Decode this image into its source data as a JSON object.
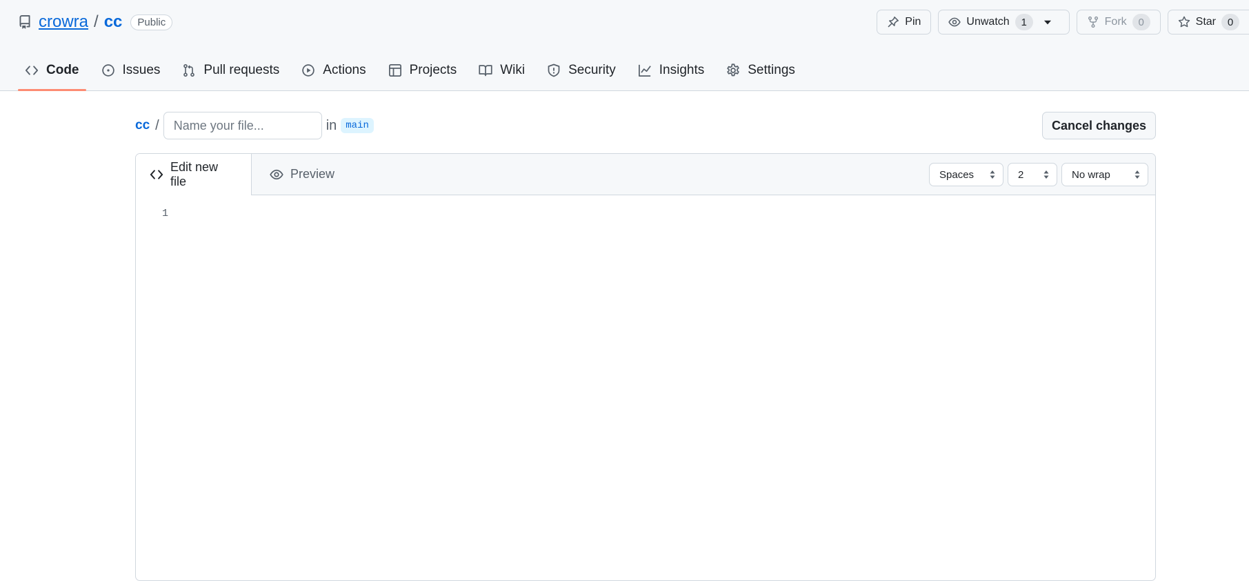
{
  "repo": {
    "owner": "crowra",
    "separator": "/",
    "name": "cc",
    "visibility": "Public"
  },
  "actions": {
    "pin_label": "Pin",
    "watch_label": "Unwatch",
    "watch_count": "1",
    "fork_label": "Fork",
    "fork_count": "0",
    "star_label": "Star",
    "star_count": "0"
  },
  "nav": {
    "items": [
      {
        "label": "Code",
        "icon": "code-icon",
        "active": true
      },
      {
        "label": "Issues",
        "icon": "issue-icon"
      },
      {
        "label": "Pull requests",
        "icon": "pull-request-icon"
      },
      {
        "label": "Actions",
        "icon": "play-icon"
      },
      {
        "label": "Projects",
        "icon": "table-icon"
      },
      {
        "label": "Wiki",
        "icon": "book-icon"
      },
      {
        "label": "Security",
        "icon": "shield-icon"
      },
      {
        "label": "Insights",
        "icon": "graph-icon"
      },
      {
        "label": "Settings",
        "icon": "gear-icon"
      }
    ]
  },
  "path": {
    "repo": "cc",
    "separator": "/",
    "filename_value": "",
    "filename_placeholder": "Name your file...",
    "in_label": "in",
    "branch": "main"
  },
  "cancel_label": "Cancel changes",
  "editor": {
    "tab_edit": "Edit new file",
    "tab_preview": "Preview",
    "indent_mode": "Spaces",
    "indent_size": "2",
    "wrap_mode": "No wrap",
    "line_numbers": [
      "1"
    ]
  },
  "colors": {
    "link": "#0969da",
    "active_underline": "#fd8c73",
    "header_bg": "#f6f8fa",
    "border": "#d0d7de"
  }
}
